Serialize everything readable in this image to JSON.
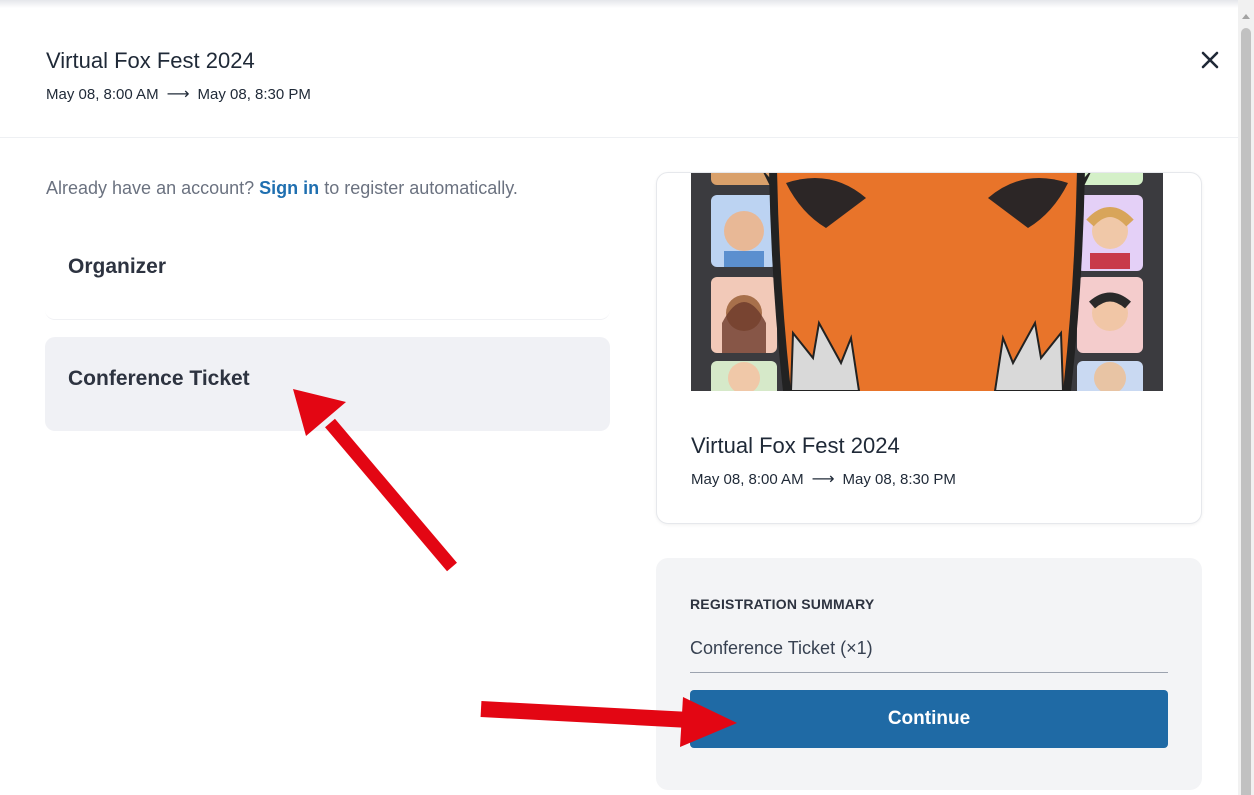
{
  "header": {
    "title": "Virtual Fox Fest 2024",
    "start": "May 08, 8:00 AM",
    "end": "May 08, 8:30 PM",
    "close_icon": "close-icon"
  },
  "signin": {
    "prefix": "Already have an account?",
    "link": "Sign in",
    "suffix": "to register automatically."
  },
  "tickets": [
    {
      "label": "Organizer",
      "selected": false
    },
    {
      "label": "Conference Ticket",
      "selected": true
    }
  ],
  "event_card": {
    "title": "Virtual Fox Fest 2024",
    "start": "May 08, 8:00 AM",
    "end": "May 08, 8:30 PM"
  },
  "summary": {
    "heading": "REGISTRATION SUMMARY",
    "item": "Conference Ticket (×1)",
    "continue_label": "Continue"
  },
  "colors": {
    "accent": "#1f6aa5",
    "link": "#1f6fb0",
    "annotation_arrow": "#e30613",
    "fox_orange": "#e8742a"
  }
}
